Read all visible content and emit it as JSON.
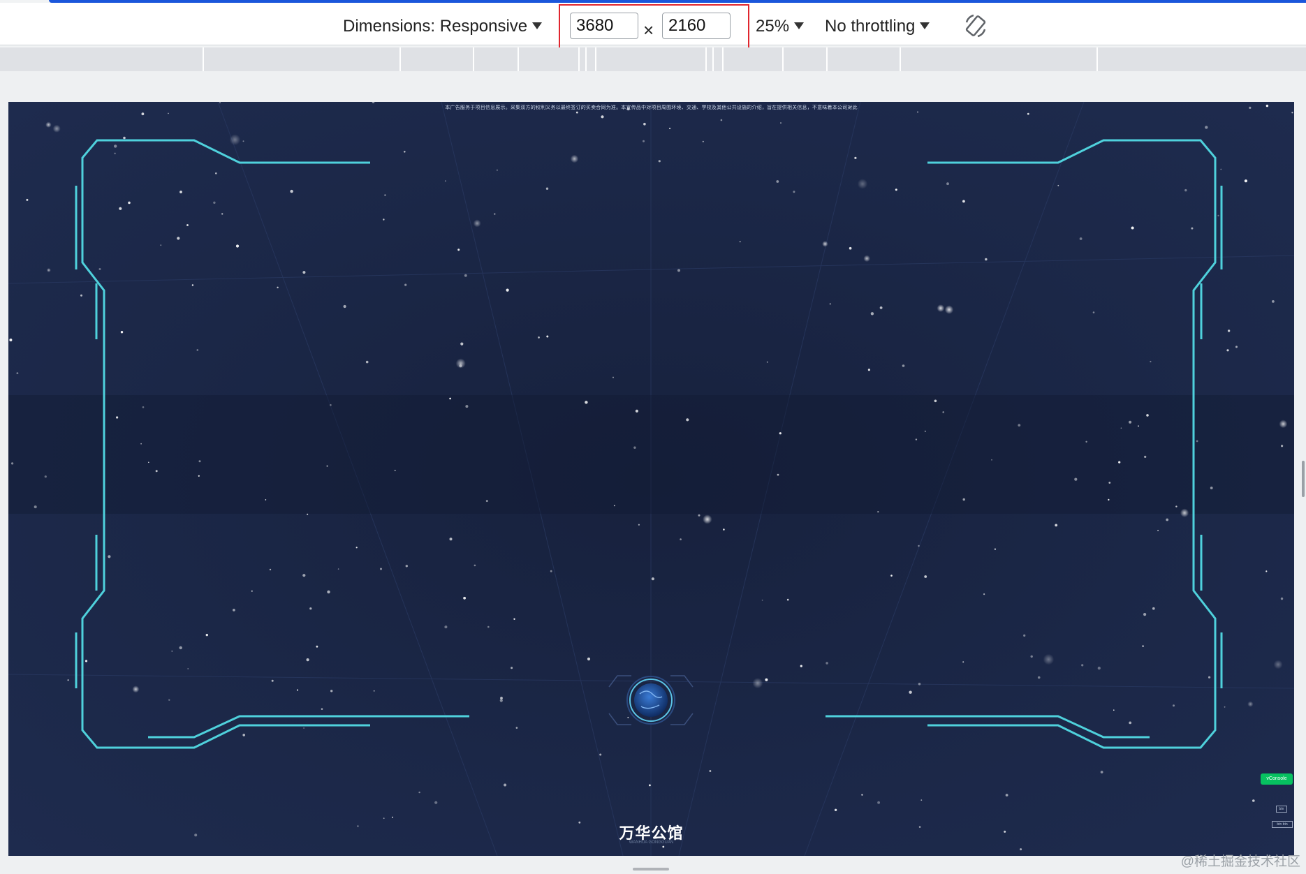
{
  "toolbar": {
    "dimensions_label": "Dimensions: Responsive",
    "width_value": "3680",
    "times_symbol": "×",
    "height_value": "2160",
    "zoom_label": "25%",
    "throttling_label": "No throttling",
    "rotate_icon": "rotate-icon"
  },
  "viewport": {
    "notice_text": "本广告服务于项目信息展示。采集双方的权利义务以最终签订的买卖合同为准。本宣传品中对项目周围环境、交通、学校及其他公共设施的介绍，旨在提供相关信息，不意味着本公司对此",
    "logo_title": "万华公馆",
    "logo_subtitle": "WANHUA GONGGUAN",
    "vconsole_label": "vConsole",
    "mini_btn_1": "btn",
    "mini_btn_2": "btn btn"
  },
  "watermark": "@稀土掘金技术社区",
  "colors": {
    "accent_cyan": "#4fd1dc",
    "space_bg": "#1b2747",
    "highlight_red": "#e0262e",
    "vconsole_green": "#07c160"
  }
}
